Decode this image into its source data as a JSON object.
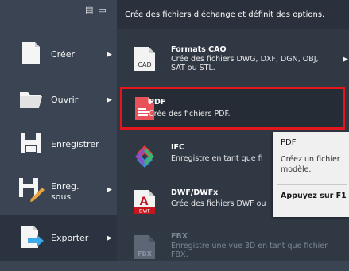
{
  "left_menu": {
    "items": [
      {
        "label": "Créer",
        "has_submenu": true
      },
      {
        "label": "Ouvrir",
        "has_submenu": true
      },
      {
        "label": "Enregistrer",
        "has_submenu": false
      },
      {
        "label": "Enreg.\nsous",
        "has_submenu": true
      },
      {
        "label": "Exporter",
        "has_submenu": true,
        "active": true
      }
    ]
  },
  "submenu": {
    "header": "Crée des fichiers d'échange et définit des options.",
    "items": [
      {
        "title": "Formats CAO",
        "desc": "Crée des fichiers DWG, DXF, DGN, OBJ, SAT ou STL.",
        "icon_text": "CAD",
        "has_submenu": true
      },
      {
        "title": "PDF",
        "desc": "Crée des fichiers PDF.",
        "highlighted": true
      },
      {
        "title": "IFC",
        "desc": "Enregistre en tant que fi"
      },
      {
        "title": "DWF/DWFx",
        "desc": "Crée des fichiers DWF ou",
        "icon_text": "DWF"
      },
      {
        "title": "FBX",
        "desc": "Enregistre une vue 3D en tant que fichier FBX.",
        "icon_text": "FBX",
        "disabled": true
      }
    ]
  },
  "tooltip": {
    "title": "PDF",
    "desc": "Créez un fichier modèle.",
    "key_hint": "Appuyez sur F1"
  },
  "colors": {
    "highlight_border": "#e2161c",
    "menu_bg": "#3b4453",
    "submenu_bg": "#303844"
  }
}
